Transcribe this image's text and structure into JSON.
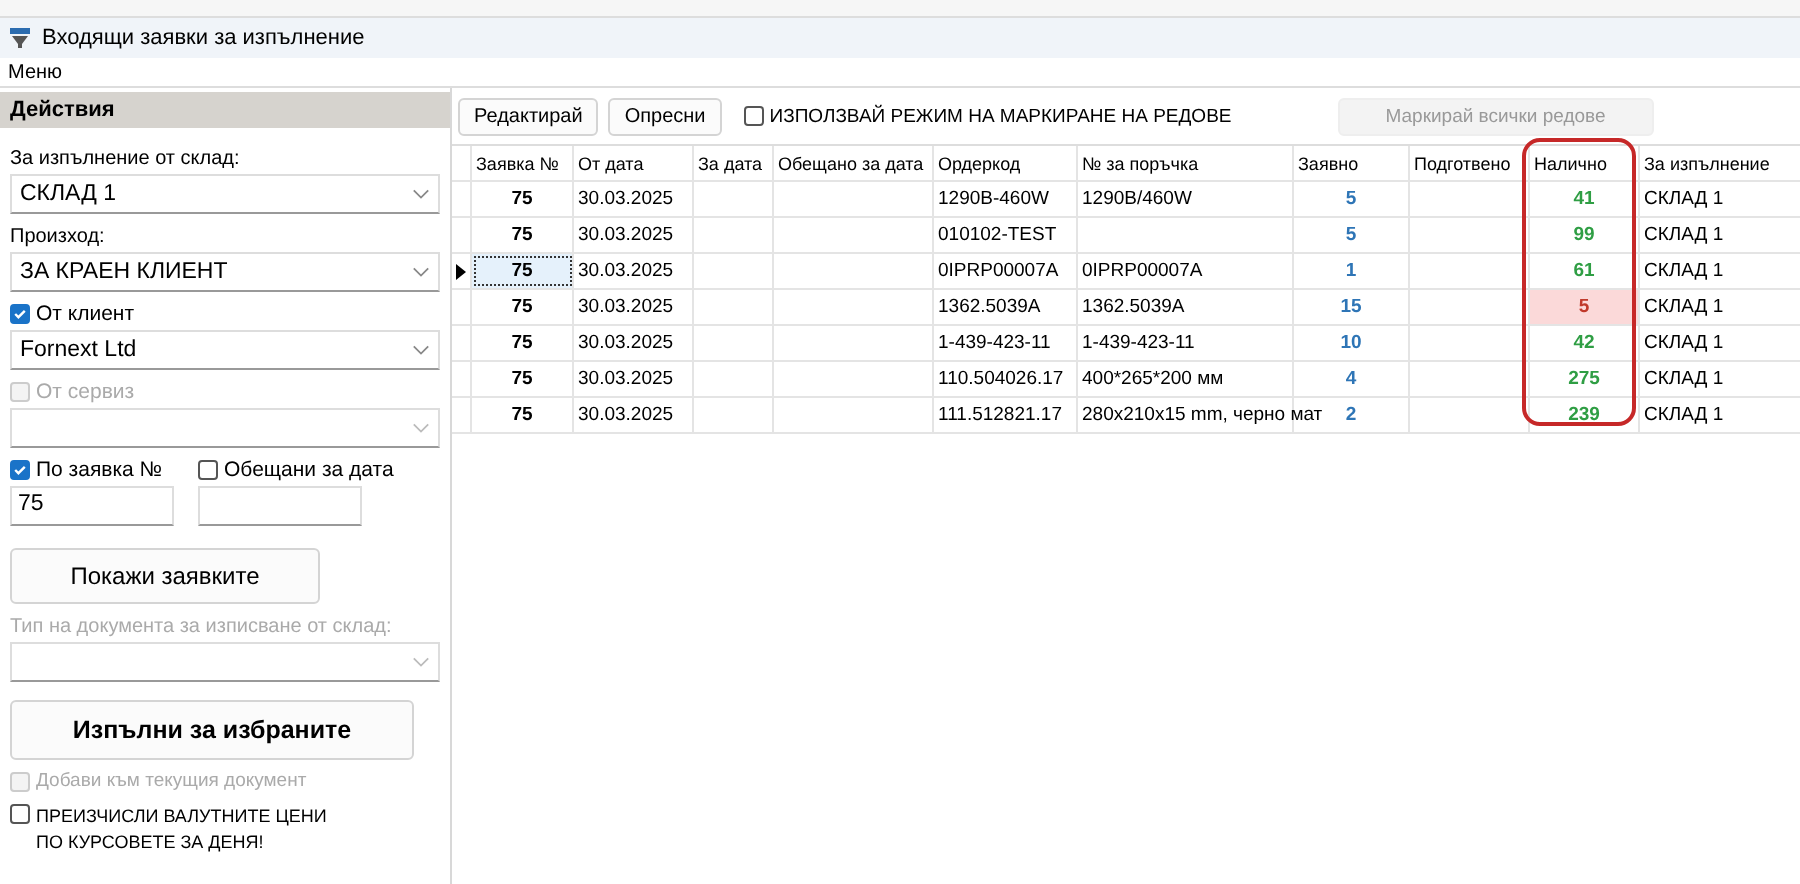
{
  "window": {
    "title": "Входящи заявки за изпълнение"
  },
  "menu": [
    "Меню"
  ],
  "sidebar": {
    "header": "Действия",
    "warehouse": {
      "label": "За изпълнение от склад:",
      "value": "СКЛАД 1"
    },
    "origin": {
      "label": "Произход:",
      "value": "ЗА КРАЕН КЛИЕНТ"
    },
    "client": {
      "label": "От клиент",
      "checked": true,
      "disabled": false,
      "value": "Fornext Ltd"
    },
    "service": {
      "label": "От сервиз",
      "checked": false,
      "disabled": true
    },
    "by_order": {
      "label": "По заявка №",
      "checked": true,
      "value": "75"
    },
    "promised": {
      "label": "Обещани за дата",
      "checked": false
    },
    "show_button": "Покажи заявките",
    "doc_type": {
      "label": "Тип на документа за изписване от склад:",
      "disabled": true
    },
    "execute_button": "Изпълни за избраните",
    "add_current": {
      "label": "Добави към текущия документ",
      "checked": false,
      "disabled": true
    },
    "recalc": {
      "label": "ПРЕИЗЧИСЛИ ВАЛУТНИТЕ ЦЕНИ ПО КУРСОВЕТЕ ЗА ДЕНЯ!",
      "checked": false,
      "disabled": false
    }
  },
  "toolbar": {
    "edit": "Редактирай",
    "refresh": "Опресни",
    "mark_mode": {
      "label": "ИЗПОЛЗВАЙ РЕЖИМ НА МАРКИРАНЕ НА РЕДОВЕ",
      "checked": false
    },
    "mark_all": {
      "label": "Маркирай всички редове",
      "disabled": true
    }
  },
  "table": {
    "columns": [
      "Заявка №",
      "От дата",
      "За дата",
      "Обещано за дата",
      "Ордеркод",
      "№ за поръчка",
      "Заявно",
      "Подготвено",
      "Налично",
      "За изпълнение"
    ],
    "rows": [
      {
        "selected": false,
        "order": "75",
        "from": "30.03.2025",
        "code": "1290B-460W",
        "po": "1290B/460W",
        "qty": "5",
        "avail": "41",
        "short": false,
        "wh": "СКЛАД 1"
      },
      {
        "selected": false,
        "order": "75",
        "from": "30.03.2025",
        "code": "010102-TEST",
        "qty": "5",
        "avail": "99",
        "short": false,
        "wh": "СКЛАД 1"
      },
      {
        "selected": true,
        "order": "75",
        "from": "30.03.2025",
        "code": "0IPRP00007A",
        "po": "0IPRP00007A",
        "qty": "1",
        "avail": "61",
        "short": false,
        "wh": "СКЛАД 1"
      },
      {
        "selected": false,
        "order": "75",
        "from": "30.03.2025",
        "code": "1362.5039A",
        "po": "1362.5039A",
        "qty": "15",
        "avail": "5",
        "short": true,
        "wh": "СКЛАД 1"
      },
      {
        "selected": false,
        "order": "75",
        "from": "30.03.2025",
        "code": "1-439-423-11",
        "po": "1-439-423-11",
        "qty": "10",
        "avail": "42",
        "short": false,
        "wh": "СКЛАД 1"
      },
      {
        "selected": false,
        "order": "75",
        "from": "30.03.2025",
        "code": "110.504026.17",
        "po": "400*265*200 мм",
        "qty": "4",
        "avail": "275",
        "short": false,
        "wh": "СКЛАД 1"
      },
      {
        "selected": false,
        "order": "75",
        "from": "30.03.2025",
        "code": "111.512821.17",
        "po": "280x210x15 mm, черно мат",
        "qty": "2",
        "avail": "239",
        "short": false,
        "wh": "СКЛАД 1"
      }
    ]
  }
}
